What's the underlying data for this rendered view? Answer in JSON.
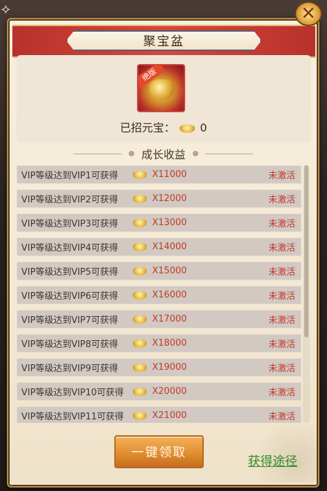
{
  "window": {
    "title": "聚宝盆",
    "close_symbol": "✕"
  },
  "header_item": {
    "badge_text": "绝版",
    "icon_name": "treasure-bowl-icon"
  },
  "collected": {
    "label": "已招元宝：",
    "value": "0"
  },
  "section": {
    "title": "成长收益"
  },
  "rows": [
    {
      "desc": "VIP等级达到VIP1可获得",
      "amount": "X11000",
      "status": "未激活"
    },
    {
      "desc": "VIP等级达到VIP2可获得",
      "amount": "X12000",
      "status": "未激活"
    },
    {
      "desc": "VIP等级达到VIP3可获得",
      "amount": "X13000",
      "status": "未激活"
    },
    {
      "desc": "VIP等级达到VIP4可获得",
      "amount": "X14000",
      "status": "未激活"
    },
    {
      "desc": "VIP等级达到VIP5可获得",
      "amount": "X15000",
      "status": "未激活"
    },
    {
      "desc": "VIP等级达到VIP6可获得",
      "amount": "X16000",
      "status": "未激活"
    },
    {
      "desc": "VIP等级达到VIP7可获得",
      "amount": "X17000",
      "status": "未激活"
    },
    {
      "desc": "VIP等级达到VIP8可获得",
      "amount": "X18000",
      "status": "未激活"
    },
    {
      "desc": "VIP等级达到VIP9可获得",
      "amount": "X19000",
      "status": "未激活"
    },
    {
      "desc": "VIP等级达到VIP10可获得",
      "amount": "X20000",
      "status": "未激活"
    },
    {
      "desc": "VIP等级达到VIP11可获得",
      "amount": "X21000",
      "status": "未激活"
    }
  ],
  "actions": {
    "claim_label": "一键领取",
    "obtain_label": "获得途径"
  },
  "colors": {
    "accent_red": "#c03a2b",
    "link_green": "#2f8b2a"
  }
}
